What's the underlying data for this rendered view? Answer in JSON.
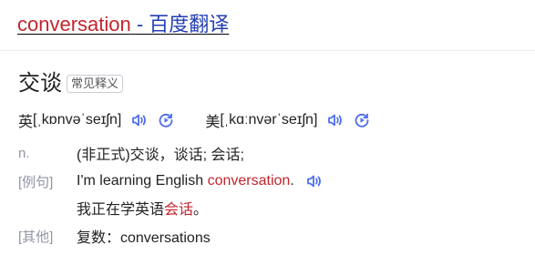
{
  "result_title": {
    "keyword": "conversation",
    "rest": " - 百度翻译"
  },
  "headword": "交谈",
  "tag": "常见释义",
  "phonetics": {
    "uk_label": "英",
    "uk": "[ˌkɒnvəˈseɪʃn]",
    "us_label": "美",
    "us": "[ˌkɑːnvərˈseɪʃn]"
  },
  "definition": {
    "pos": "n.",
    "text": "(非正式)交谈，谈话; 会话;"
  },
  "example": {
    "label": "[例句]",
    "en_before": "I'm learning English ",
    "en_highlight": "conversation",
    "en_after": ".",
    "zh_before": "我正在学英语",
    "zh_highlight": "会话",
    "zh_after": "。"
  },
  "other": {
    "label": "[其他]",
    "text": "复数：conversations"
  },
  "icons": {
    "speaker": "speaker-icon",
    "replay": "replay-icon",
    "accent_color": "#4e6ef2"
  },
  "colors": {
    "title_link": "#2440b3",
    "keyword": "#c3262e",
    "label": "#9195a3"
  }
}
